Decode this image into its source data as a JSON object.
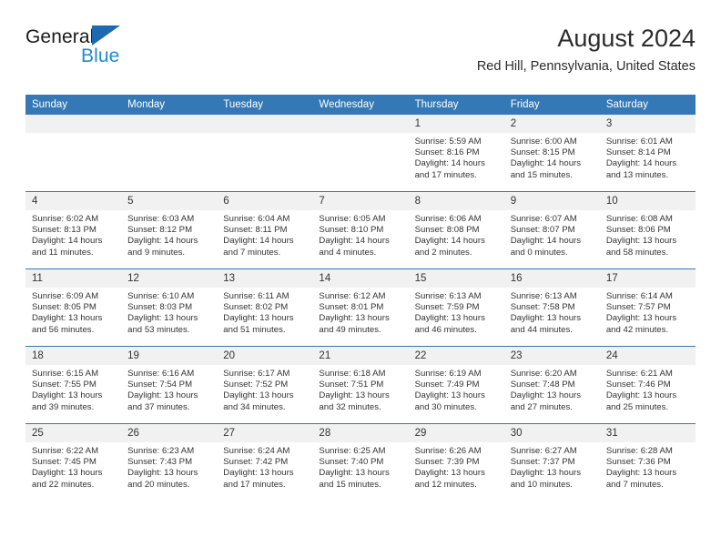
{
  "brand": {
    "name_part1": "General",
    "name_part2": "Blue",
    "triangle_color": "#1c6bb0",
    "blue_color": "#1f8ad4"
  },
  "header": {
    "title": "August 2024",
    "subtitle": "Red Hill, Pennsylvania, United States"
  },
  "theme": {
    "header_row_bg": "#3479b5",
    "daynum_bg": "#f1f1f1",
    "text_color": "#333333"
  },
  "calendar": {
    "weekday_headers": [
      "Sunday",
      "Monday",
      "Tuesday",
      "Wednesday",
      "Thursday",
      "Friday",
      "Saturday"
    ],
    "weeks": [
      [
        {
          "day": "",
          "lines": []
        },
        {
          "day": "",
          "lines": []
        },
        {
          "day": "",
          "lines": []
        },
        {
          "day": "",
          "lines": []
        },
        {
          "day": "1",
          "lines": [
            "Sunrise: 5:59 AM",
            "Sunset: 8:16 PM",
            "Daylight: 14 hours",
            "and 17 minutes."
          ]
        },
        {
          "day": "2",
          "lines": [
            "Sunrise: 6:00 AM",
            "Sunset: 8:15 PM",
            "Daylight: 14 hours",
            "and 15 minutes."
          ]
        },
        {
          "day": "3",
          "lines": [
            "Sunrise: 6:01 AM",
            "Sunset: 8:14 PM",
            "Daylight: 14 hours",
            "and 13 minutes."
          ]
        }
      ],
      [
        {
          "day": "4",
          "lines": [
            "Sunrise: 6:02 AM",
            "Sunset: 8:13 PM",
            "Daylight: 14 hours",
            "and 11 minutes."
          ]
        },
        {
          "day": "5",
          "lines": [
            "Sunrise: 6:03 AM",
            "Sunset: 8:12 PM",
            "Daylight: 14 hours",
            "and 9 minutes."
          ]
        },
        {
          "day": "6",
          "lines": [
            "Sunrise: 6:04 AM",
            "Sunset: 8:11 PM",
            "Daylight: 14 hours",
            "and 7 minutes."
          ]
        },
        {
          "day": "7",
          "lines": [
            "Sunrise: 6:05 AM",
            "Sunset: 8:10 PM",
            "Daylight: 14 hours",
            "and 4 minutes."
          ]
        },
        {
          "day": "8",
          "lines": [
            "Sunrise: 6:06 AM",
            "Sunset: 8:08 PM",
            "Daylight: 14 hours",
            "and 2 minutes."
          ]
        },
        {
          "day": "9",
          "lines": [
            "Sunrise: 6:07 AM",
            "Sunset: 8:07 PM",
            "Daylight: 14 hours",
            "and 0 minutes."
          ]
        },
        {
          "day": "10",
          "lines": [
            "Sunrise: 6:08 AM",
            "Sunset: 8:06 PM",
            "Daylight: 13 hours",
            "and 58 minutes."
          ]
        }
      ],
      [
        {
          "day": "11",
          "lines": [
            "Sunrise: 6:09 AM",
            "Sunset: 8:05 PM",
            "Daylight: 13 hours",
            "and 56 minutes."
          ]
        },
        {
          "day": "12",
          "lines": [
            "Sunrise: 6:10 AM",
            "Sunset: 8:03 PM",
            "Daylight: 13 hours",
            "and 53 minutes."
          ]
        },
        {
          "day": "13",
          "lines": [
            "Sunrise: 6:11 AM",
            "Sunset: 8:02 PM",
            "Daylight: 13 hours",
            "and 51 minutes."
          ]
        },
        {
          "day": "14",
          "lines": [
            "Sunrise: 6:12 AM",
            "Sunset: 8:01 PM",
            "Daylight: 13 hours",
            "and 49 minutes."
          ]
        },
        {
          "day": "15",
          "lines": [
            "Sunrise: 6:13 AM",
            "Sunset: 7:59 PM",
            "Daylight: 13 hours",
            "and 46 minutes."
          ]
        },
        {
          "day": "16",
          "lines": [
            "Sunrise: 6:13 AM",
            "Sunset: 7:58 PM",
            "Daylight: 13 hours",
            "and 44 minutes."
          ]
        },
        {
          "day": "17",
          "lines": [
            "Sunrise: 6:14 AM",
            "Sunset: 7:57 PM",
            "Daylight: 13 hours",
            "and 42 minutes."
          ]
        }
      ],
      [
        {
          "day": "18",
          "lines": [
            "Sunrise: 6:15 AM",
            "Sunset: 7:55 PM",
            "Daylight: 13 hours",
            "and 39 minutes."
          ]
        },
        {
          "day": "19",
          "lines": [
            "Sunrise: 6:16 AM",
            "Sunset: 7:54 PM",
            "Daylight: 13 hours",
            "and 37 minutes."
          ]
        },
        {
          "day": "20",
          "lines": [
            "Sunrise: 6:17 AM",
            "Sunset: 7:52 PM",
            "Daylight: 13 hours",
            "and 34 minutes."
          ]
        },
        {
          "day": "21",
          "lines": [
            "Sunrise: 6:18 AM",
            "Sunset: 7:51 PM",
            "Daylight: 13 hours",
            "and 32 minutes."
          ]
        },
        {
          "day": "22",
          "lines": [
            "Sunrise: 6:19 AM",
            "Sunset: 7:49 PM",
            "Daylight: 13 hours",
            "and 30 minutes."
          ]
        },
        {
          "day": "23",
          "lines": [
            "Sunrise: 6:20 AM",
            "Sunset: 7:48 PM",
            "Daylight: 13 hours",
            "and 27 minutes."
          ]
        },
        {
          "day": "24",
          "lines": [
            "Sunrise: 6:21 AM",
            "Sunset: 7:46 PM",
            "Daylight: 13 hours",
            "and 25 minutes."
          ]
        }
      ],
      [
        {
          "day": "25",
          "lines": [
            "Sunrise: 6:22 AM",
            "Sunset: 7:45 PM",
            "Daylight: 13 hours",
            "and 22 minutes."
          ]
        },
        {
          "day": "26",
          "lines": [
            "Sunrise: 6:23 AM",
            "Sunset: 7:43 PM",
            "Daylight: 13 hours",
            "and 20 minutes."
          ]
        },
        {
          "day": "27",
          "lines": [
            "Sunrise: 6:24 AM",
            "Sunset: 7:42 PM",
            "Daylight: 13 hours",
            "and 17 minutes."
          ]
        },
        {
          "day": "28",
          "lines": [
            "Sunrise: 6:25 AM",
            "Sunset: 7:40 PM",
            "Daylight: 13 hours",
            "and 15 minutes."
          ]
        },
        {
          "day": "29",
          "lines": [
            "Sunrise: 6:26 AM",
            "Sunset: 7:39 PM",
            "Daylight: 13 hours",
            "and 12 minutes."
          ]
        },
        {
          "day": "30",
          "lines": [
            "Sunrise: 6:27 AM",
            "Sunset: 7:37 PM",
            "Daylight: 13 hours",
            "and 10 minutes."
          ]
        },
        {
          "day": "31",
          "lines": [
            "Sunrise: 6:28 AM",
            "Sunset: 7:36 PM",
            "Daylight: 13 hours",
            "and 7 minutes."
          ]
        }
      ]
    ]
  }
}
